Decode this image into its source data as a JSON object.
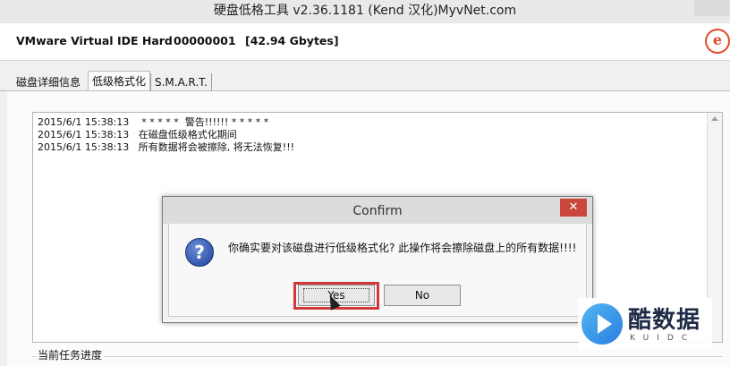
{
  "window": {
    "title": "硬盘低格工具 v2.36.1181 (Kend 汉化)MyvNet.com"
  },
  "header": {
    "device_name": "VMware Virtual IDE Hard",
    "serial": "00000001",
    "capacity": "[42.94 Gbytes]",
    "logo_letter": "e"
  },
  "tabs": [
    {
      "label": "磁盘详细信息"
    },
    {
      "label": "低级格式化"
    },
    {
      "label": "S.M.A.R.T."
    }
  ],
  "log": {
    "lines": [
      "2015/6/1 15:38:13    * * * * *  警告!!!!!! * * * * *",
      "2015/6/1 15:38:13   在磁盘低级格式化期间",
      "2015/6/1 15:38:13   所有数据将会被擦除, 将无法恢复!!!"
    ]
  },
  "progress": {
    "label": "当前任务进度"
  },
  "dialog": {
    "title": "Confirm",
    "close_glyph": "✕",
    "question_glyph": "?",
    "message": "你确实要对该磁盘进行低级格式化? 此操作将会擦除磁盘上的所有数据!!!!",
    "yes_label": "Yes",
    "no_label": "No"
  },
  "watermark": {
    "text": "酷数据",
    "sub": "KUIDC"
  },
  "colors": {
    "highlight": "#d2383a",
    "close_button": "#c9473d",
    "logo": "#e04a2a"
  }
}
